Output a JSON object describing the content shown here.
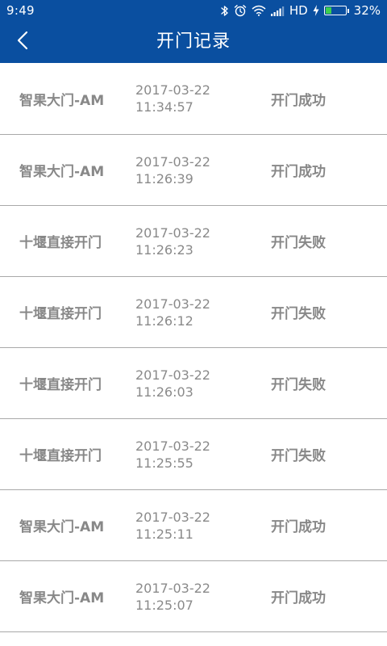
{
  "status_bar": {
    "time": "9:49",
    "network": "HD",
    "battery_percent": "32%",
    "battery_level": 0.32,
    "icons": [
      "bluetooth-icon",
      "alarm-icon",
      "wifi-icon",
      "signal-icon",
      "charging-icon",
      "battery-icon"
    ]
  },
  "header": {
    "title": "开门记录",
    "back_icon": "chevron-left-icon"
  },
  "colors": {
    "accent": "#0a4fa0",
    "text_gray": "#888888",
    "divider": "#a9a9a9"
  },
  "records": [
    {
      "gate": "智果大门-AM",
      "date": "2017-03-22",
      "time": "11:34:57",
      "result": "开门成功"
    },
    {
      "gate": "智果大门-AM",
      "date": "2017-03-22",
      "time": "11:26:39",
      "result": "开门成功"
    },
    {
      "gate": "十堰直接开门",
      "date": "2017-03-22",
      "time": "11:26:23",
      "result": "开门失败"
    },
    {
      "gate": "十堰直接开门",
      "date": "2017-03-22",
      "time": "11:26:12",
      "result": "开门失败"
    },
    {
      "gate": "十堰直接开门",
      "date": "2017-03-22",
      "time": "11:26:03",
      "result": "开门失败"
    },
    {
      "gate": "十堰直接开门",
      "date": "2017-03-22",
      "time": "11:25:55",
      "result": "开门失败"
    },
    {
      "gate": "智果大门-AM",
      "date": "2017-03-22",
      "time": "11:25:11",
      "result": "开门成功"
    },
    {
      "gate": "智果大门-AM",
      "date": "2017-03-22",
      "time": "11:25:07",
      "result": "开门成功"
    }
  ]
}
